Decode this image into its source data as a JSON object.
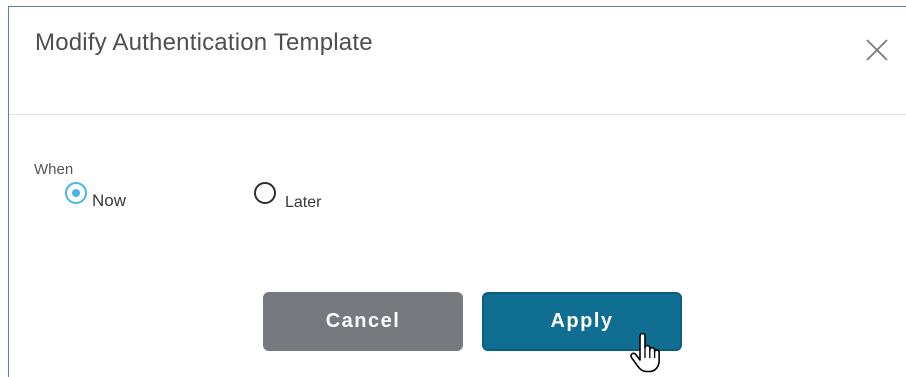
{
  "dialog": {
    "title": "Modify Authentication Template",
    "close_icon": "close-icon"
  },
  "schedule": {
    "label": "When",
    "options": [
      {
        "label": "Now",
        "selected": true
      },
      {
        "label": "Later",
        "selected": false
      }
    ]
  },
  "actions": {
    "cancel_label": "Cancel",
    "apply_label": "Apply"
  },
  "colors": {
    "primary": "#0f6e92",
    "secondary": "#767a7e",
    "radio_accent": "#49b6e6",
    "dialog_border": "#5a7fb5"
  },
  "pointer": {
    "icon": "hand-pointer-icon"
  }
}
